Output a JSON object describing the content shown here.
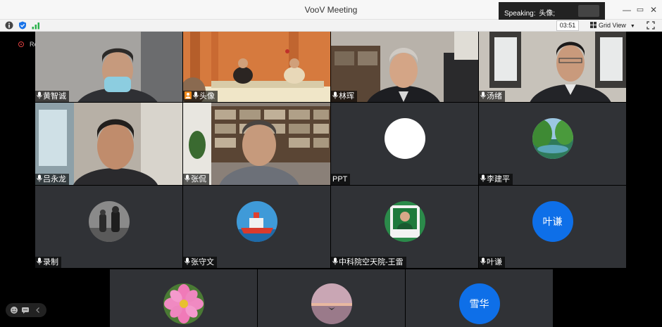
{
  "window": {
    "title": "VooV Meeting",
    "speaking_label": "Speaking:",
    "speaking_name": "头像;",
    "minimize": "—",
    "maximize": "▭",
    "close": "✕"
  },
  "toolbar": {
    "timer": "03:51",
    "view_label": "Grid View",
    "view_chevron": "▼"
  },
  "recording": {
    "label": "Recording"
  },
  "participants": [
    {
      "name": "黄智诚"
    },
    {
      "name": "头像",
      "host": true,
      "speaking": true
    },
    {
      "name": "林珲"
    },
    {
      "name": "汤绪"
    },
    {
      "name": "吕永龙"
    },
    {
      "name": "张侃"
    },
    {
      "name": "PPT"
    },
    {
      "name": "李建平"
    },
    {
      "name": "录制"
    },
    {
      "name": "张守文"
    },
    {
      "name": "中科院空天院-王雷"
    },
    {
      "name": "叶谦",
      "avatar_text": "叶谦"
    },
    {
      "name": ""
    },
    {
      "name": ""
    },
    {
      "name": "",
      "avatar_text": "雪华"
    }
  ],
  "colors": {
    "avatar_blue": "#0e6fe8",
    "active_border": "#1eb85a",
    "tile_bg": "#303236"
  }
}
